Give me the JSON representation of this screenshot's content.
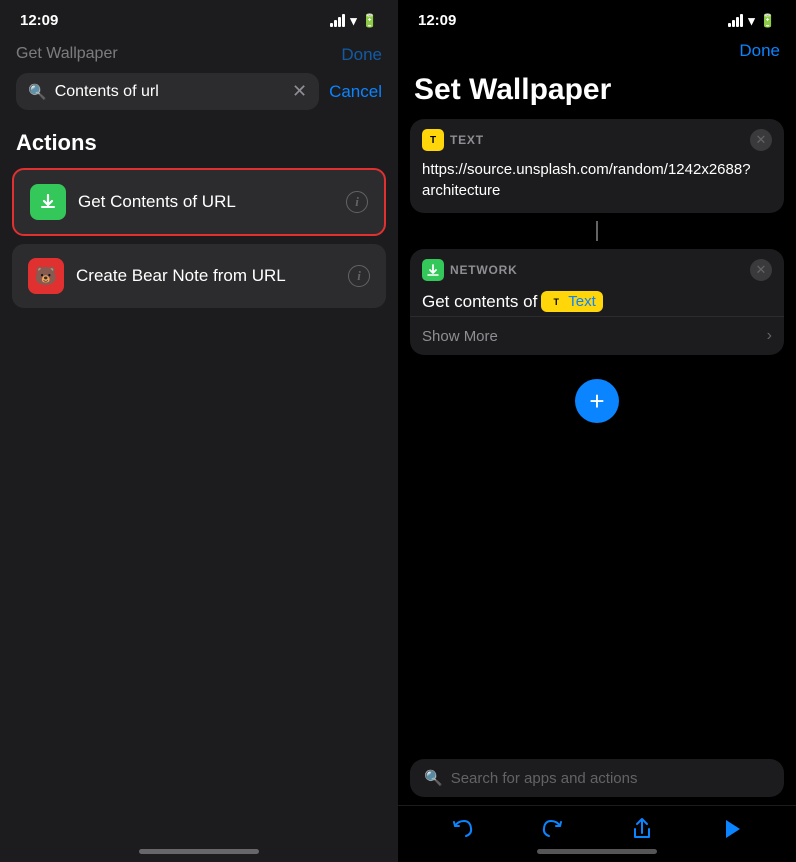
{
  "left": {
    "status_time": "12:09",
    "peek_title": "Get Wallpaper",
    "peek_done": "Done",
    "search": {
      "value": "Contents of url",
      "placeholder": "Search"
    },
    "cancel_label": "Cancel",
    "actions_header": "Actions",
    "items": [
      {
        "id": "get-contents-url",
        "label": "Get Contents of URL",
        "icon_type": "green",
        "selected": true
      },
      {
        "id": "create-bear-note",
        "label": "Create Bear Note from URL",
        "icon_type": "red",
        "selected": false
      }
    ]
  },
  "right": {
    "status_time": "12:09",
    "done_label": "Done",
    "title": "Set Wallpaper",
    "text_card": {
      "type_label": "TEXT",
      "content": "https://source.unsplash.com/random/1242x2688?architecture"
    },
    "network_card": {
      "type_label": "NETWORK",
      "body_prefix": "Get contents of",
      "token_label": "Text"
    },
    "show_more": "Show More",
    "search_placeholder": "Search for apps and actions",
    "toolbar": {
      "undo_label": "Undo",
      "redo_label": "Redo",
      "share_label": "Share",
      "play_label": "Play"
    }
  }
}
